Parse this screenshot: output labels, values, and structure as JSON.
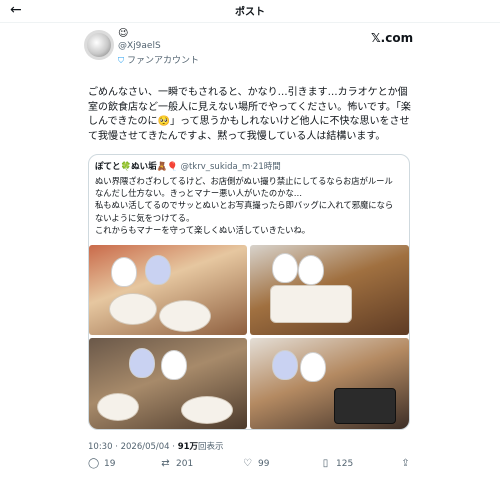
{
  "topbar": {
    "back_icon": "back-arrow-icon",
    "title": "ポスト"
  },
  "post": {
    "author_emoji": "😉",
    "author_handle": "@Xj9aelS",
    "badge_label": "ファンアカウント",
    "source_label": "𝕏.com",
    "text": "ごめんなさい、一瞬でもされると、かなり…引きます…カラオケとか個室の飲食店など一般人に見えない場所でやってください。怖いです。「楽しんできたのに🥺」って思うかもしれないけど他人に不快な思いをさせて我慢させてきたんですよ、黙って我慢している人は結構います。"
  },
  "quote": {
    "name": "ぽてと🍀ぬい垢🧸🎈",
    "handle": "@tkrv_sukida_m",
    "time": "·21時間",
    "text": "ぬい界隈ざわざわしてるけど、お店側がぬい撮り禁止にしてるならお店がルールなんだし仕方ない。きっとマナー悪い人がいたのかな…\n私もぬい活してるのでサッとぬいとお写真撮ったら即バッグに入れて邪魔にならないように気をつけてる。\nこれからもマナーを守って楽しくぬい活していきたいね。"
  },
  "meta": {
    "time": "10:30 · 2026/05/04 · ",
    "views": "91万",
    "views_label": "回表示"
  },
  "actions": {
    "replies": "19",
    "reposts": "201",
    "likes": "99",
    "bookmarks": "125"
  },
  "icons": {
    "reply": "speech-bubble-icon",
    "repost": "repost-arrows-icon",
    "like": "heart-icon",
    "bookmark": "bookmark-icon",
    "share": "share-icon"
  },
  "colors": {
    "accent": "#1d9bf0",
    "muted": "#536471"
  }
}
